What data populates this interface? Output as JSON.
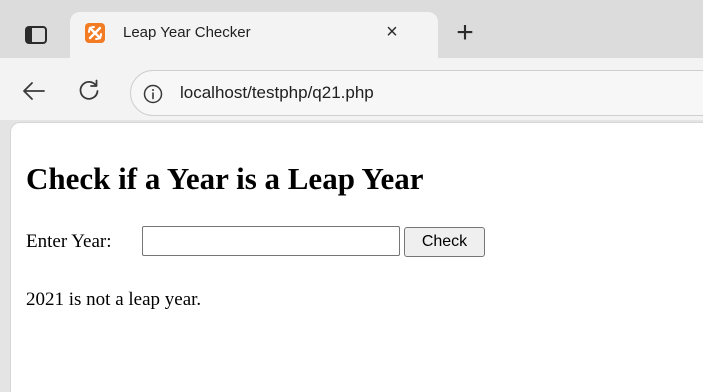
{
  "browser": {
    "tab": {
      "title": "Leap Year Checker",
      "close_glyph": "×",
      "favicon_icon": "xampp-icon",
      "favicon_color": "#f37b24"
    },
    "new_tab_glyph": "+",
    "address_bar": {
      "url": "localhost/testphp/q21.php"
    }
  },
  "page": {
    "heading": "Check if a Year is a Leap Year",
    "form": {
      "label": "Enter Year:",
      "input_value": "",
      "button_label": "Check"
    },
    "result": "2021 is not a leap year."
  }
}
